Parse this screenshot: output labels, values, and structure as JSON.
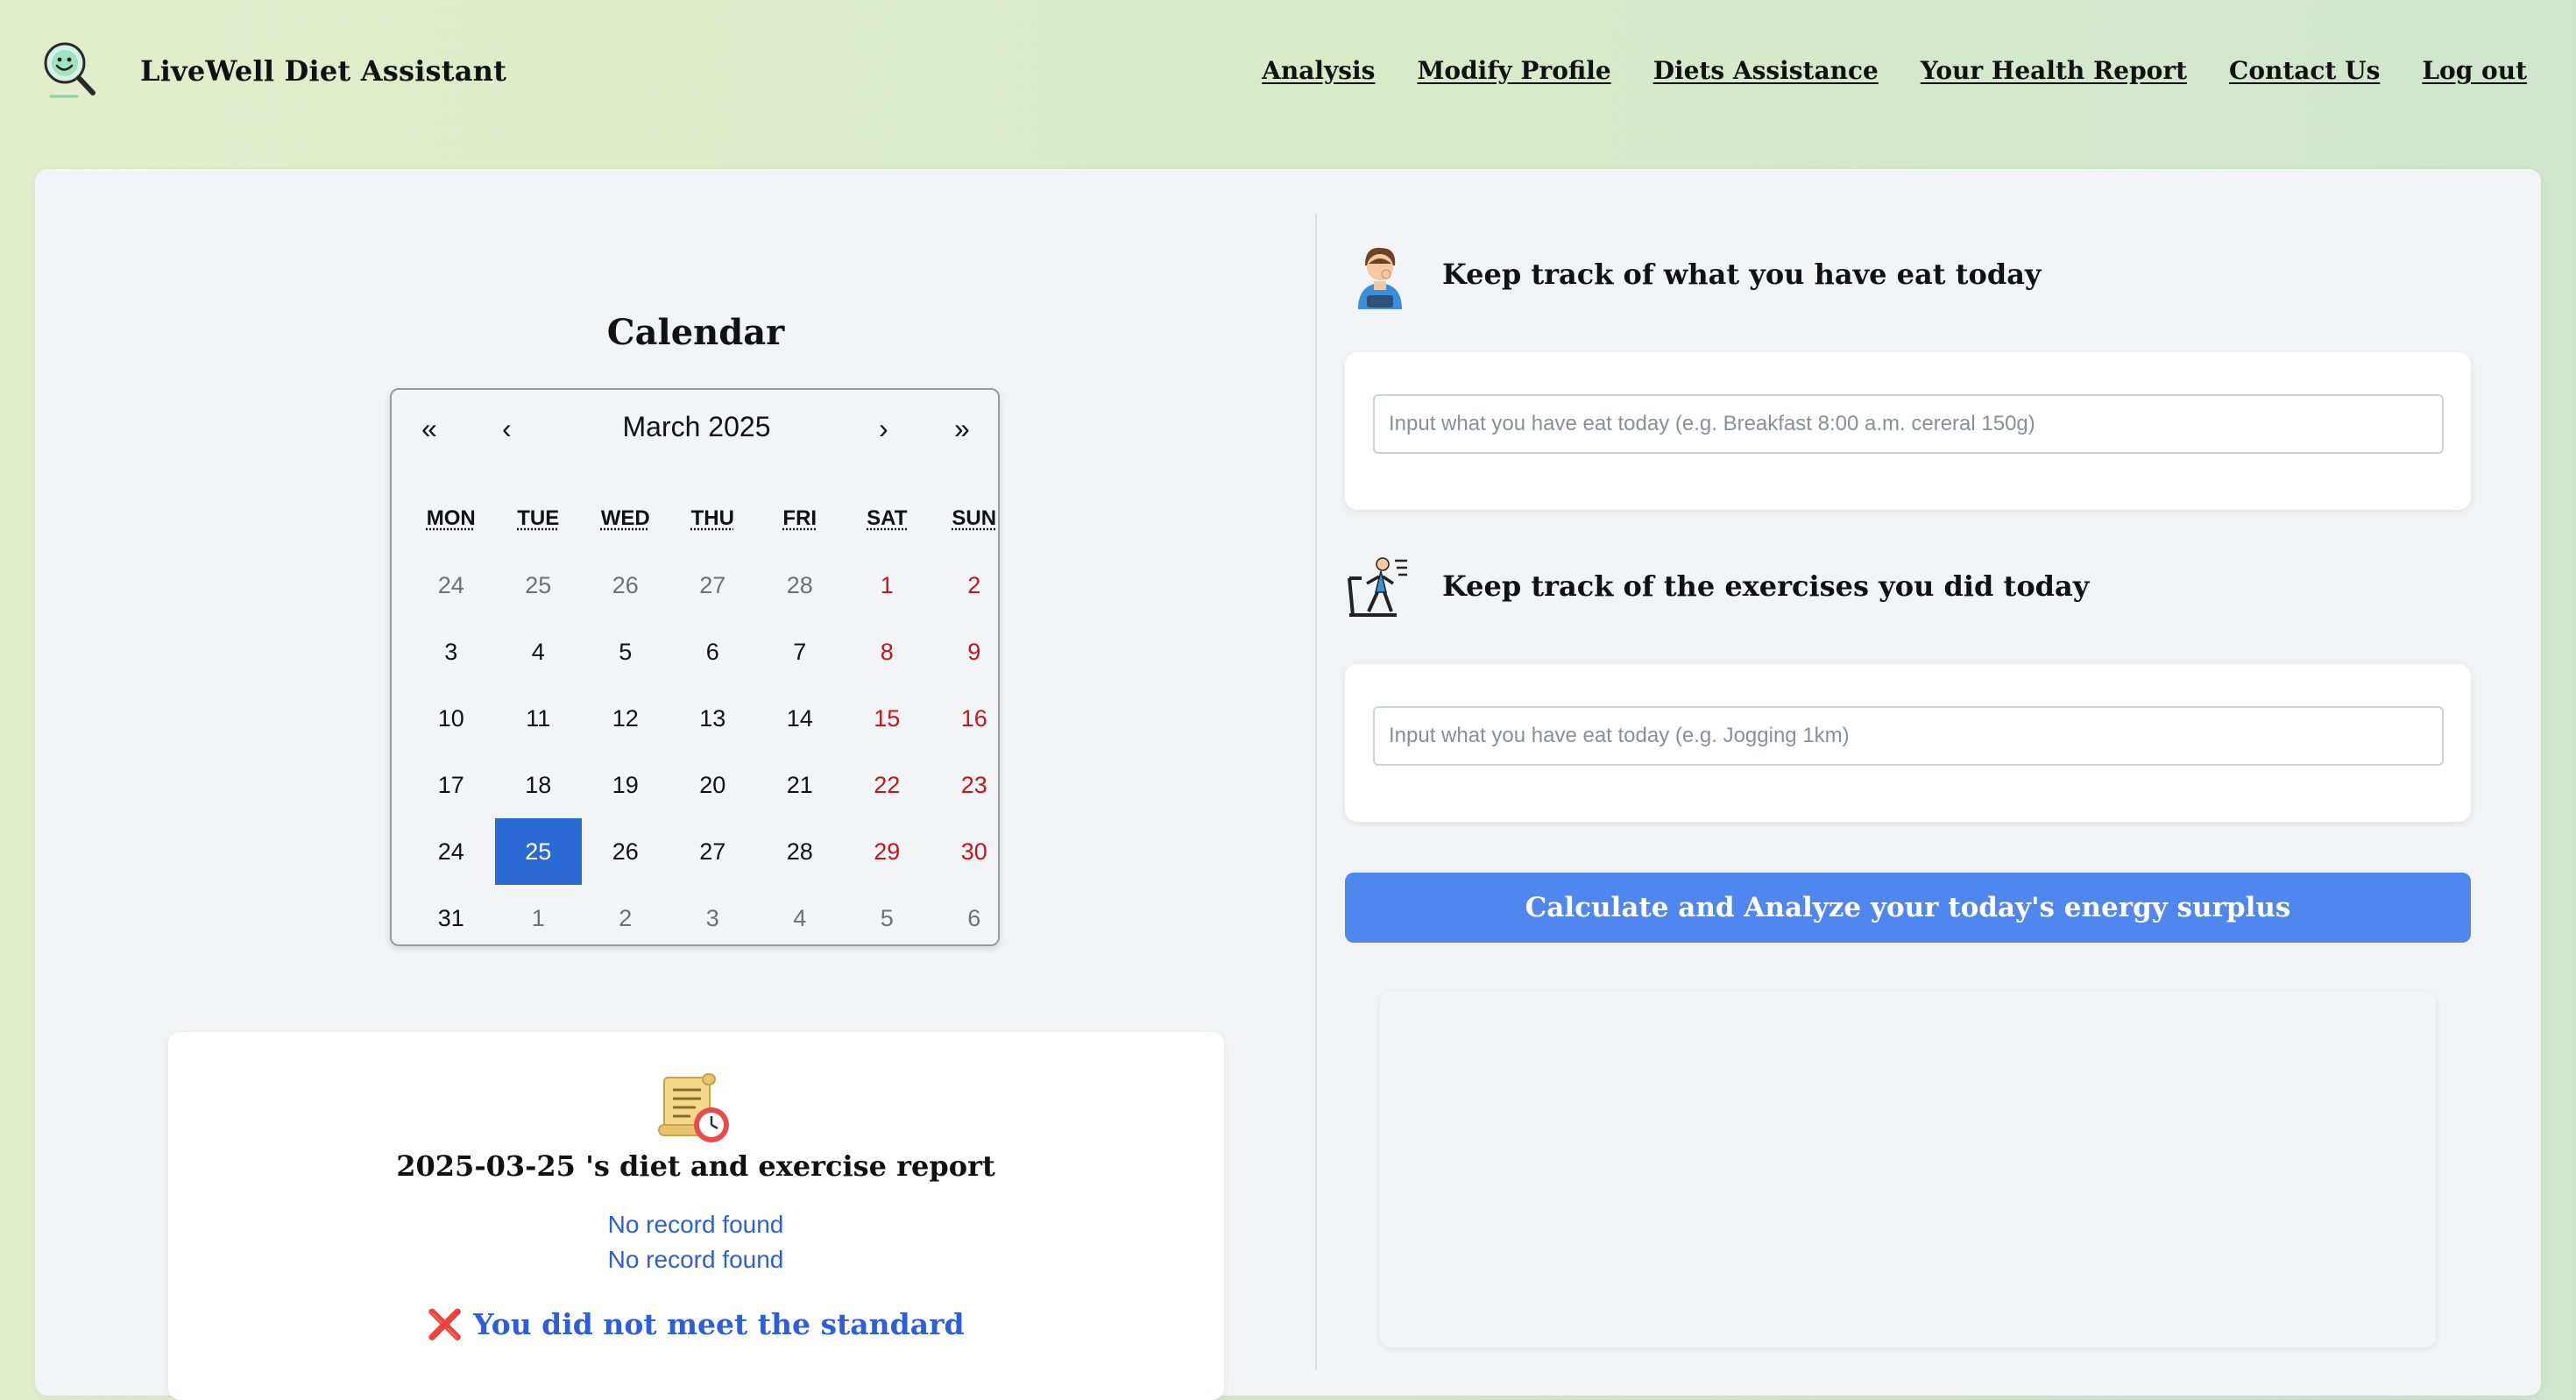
{
  "header": {
    "brand": "LiveWell Diet Assistant",
    "nav": [
      "Analysis",
      "Modify Profile",
      "Diets Assistance",
      "Your Health Report",
      "Contact Us",
      "Log out"
    ]
  },
  "calendar": {
    "title": "Calendar",
    "nav": {
      "prev_year": "«",
      "prev_month": "‹",
      "next_month": "›",
      "next_year": "»"
    },
    "month_label": "March 2025",
    "weekdays": [
      "MON",
      "TUE",
      "WED",
      "THU",
      "FRI",
      "SAT",
      "SUN"
    ],
    "days": [
      {
        "d": "24",
        "other": true
      },
      {
        "d": "25",
        "other": true
      },
      {
        "d": "26",
        "other": true
      },
      {
        "d": "27",
        "other": true
      },
      {
        "d": "28",
        "other": true
      },
      {
        "d": "1",
        "weekend": true
      },
      {
        "d": "2",
        "weekend": true
      },
      {
        "d": "3"
      },
      {
        "d": "4"
      },
      {
        "d": "5"
      },
      {
        "d": "6"
      },
      {
        "d": "7"
      },
      {
        "d": "8",
        "weekend": true
      },
      {
        "d": "9",
        "weekend": true
      },
      {
        "d": "10"
      },
      {
        "d": "11"
      },
      {
        "d": "12"
      },
      {
        "d": "13"
      },
      {
        "d": "14"
      },
      {
        "d": "15",
        "weekend": true
      },
      {
        "d": "16",
        "weekend": true
      },
      {
        "d": "17"
      },
      {
        "d": "18"
      },
      {
        "d": "19"
      },
      {
        "d": "20"
      },
      {
        "d": "21"
      },
      {
        "d": "22",
        "weekend": true
      },
      {
        "d": "23",
        "weekend": true
      },
      {
        "d": "24"
      },
      {
        "d": "25",
        "selected": true
      },
      {
        "d": "26"
      },
      {
        "d": "27"
      },
      {
        "d": "28"
      },
      {
        "d": "29",
        "weekend": true
      },
      {
        "d": "30",
        "weekend": true
      },
      {
        "d": "31"
      },
      {
        "d": "1",
        "other": true
      },
      {
        "d": "2",
        "other": true
      },
      {
        "d": "3",
        "other": true
      },
      {
        "d": "4",
        "other": true
      },
      {
        "d": "5",
        "other": true
      },
      {
        "d": "6",
        "other": true
      }
    ]
  },
  "report": {
    "icon": "scroll-clock-icon",
    "title": "2025-03-25 's diet and exercise report",
    "diet_record": "No record found",
    "exercise_record": "No record found",
    "standard_mark": "❌",
    "standard_text": "You did not meet the standard"
  },
  "food": {
    "icon": "person-eating-icon",
    "title": "Keep track of what you have eat today",
    "placeholder": "Input what you have eat today (e.g. Breakfast 8:00 a.m. cereral 150g)"
  },
  "exercise": {
    "icon": "treadmill-runner-icon",
    "title": "Keep track of the exercises you did today",
    "placeholder": "Input what you have eat today (e.g. Jogging 1km)"
  },
  "calculate_button": "Calculate and Analyze your today's energy surplus",
  "colors": {
    "accent": "#4f87ee",
    "selected_day": "#2b6ad3",
    "weekend": "#c4161c",
    "report_text": "#2e5fd6"
  }
}
